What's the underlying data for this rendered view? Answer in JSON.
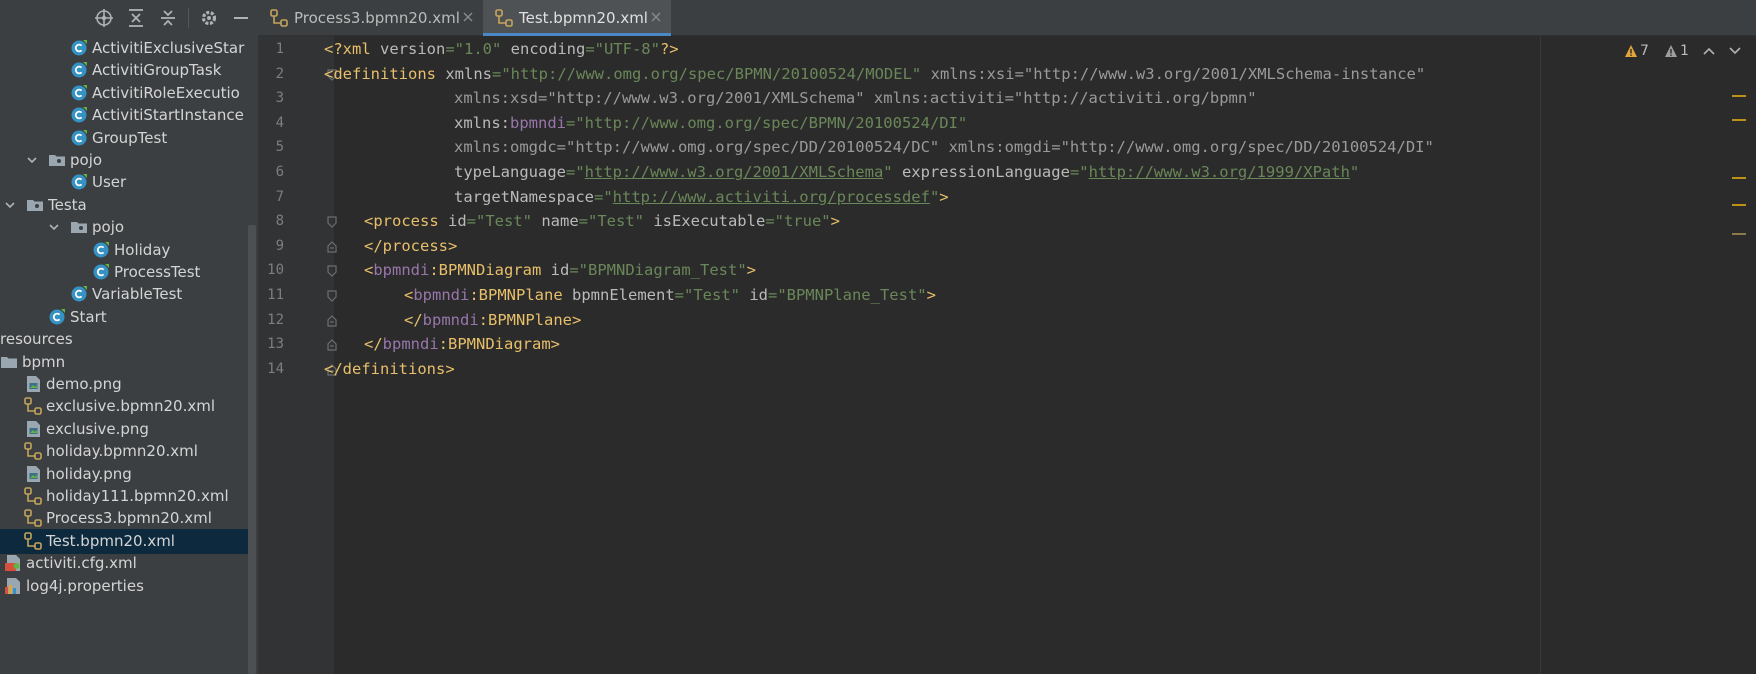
{
  "sidebar": {
    "toolbar": [
      "target-icon",
      "collapse-all-icon",
      "expand-all-icon",
      "gear-icon",
      "minimize-icon"
    ],
    "rows": [
      {
        "label": "ActivitiExclusiveStar",
        "icon": "java-class-icon",
        "indent": 70,
        "chevron": ""
      },
      {
        "label": "ActivitiGroupTask",
        "icon": "java-class-icon",
        "indent": 70,
        "chevron": ""
      },
      {
        "label": "ActivitiRoleExecutio",
        "icon": "java-class-icon",
        "indent": 70,
        "chevron": ""
      },
      {
        "label": "ActivitiStartInstance",
        "icon": "java-class-icon",
        "indent": 70,
        "chevron": ""
      },
      {
        "label": "GroupTest",
        "icon": "java-class-icon",
        "indent": 70,
        "chevron": ""
      },
      {
        "label": "pojo",
        "icon": "package-icon",
        "indent": 48,
        "chevron": "down"
      },
      {
        "label": "User",
        "icon": "java-class-icon",
        "indent": 70,
        "chevron": ""
      },
      {
        "label": "Testa",
        "icon": "package-icon",
        "indent": 26,
        "chevron": "down"
      },
      {
        "label": "pojo",
        "icon": "package-icon",
        "indent": 70,
        "chevron": "down"
      },
      {
        "label": "Holiday",
        "icon": "java-class-icon",
        "indent": 92,
        "chevron": ""
      },
      {
        "label": "ProcessTest",
        "icon": "java-class-icon",
        "indent": 92,
        "chevron": ""
      },
      {
        "label": "VariableTest",
        "icon": "java-class-icon",
        "indent": 70,
        "chevron": ""
      },
      {
        "label": "Start",
        "icon": "java-class-icon",
        "indent": 48,
        "chevron": ""
      },
      {
        "label": "resources",
        "icon": "",
        "indent": 0,
        "chevron": ""
      },
      {
        "label": "bpmn",
        "icon": "folder-icon",
        "indent": 0,
        "chevron": ""
      },
      {
        "label": "demo.png",
        "icon": "image-file-icon",
        "indent": 24,
        "chevron": ""
      },
      {
        "label": "exclusive.bpmn20.xml",
        "icon": "bpmn-file-icon",
        "indent": 24,
        "chevron": ""
      },
      {
        "label": "exclusive.png",
        "icon": "image-file-icon",
        "indent": 24,
        "chevron": ""
      },
      {
        "label": "holiday.bpmn20.xml",
        "icon": "bpmn-file-icon",
        "indent": 24,
        "chevron": ""
      },
      {
        "label": "holiday.png",
        "icon": "image-file-icon",
        "indent": 24,
        "chevron": ""
      },
      {
        "label": "holiday111.bpmn20.xml",
        "icon": "bpmn-file-icon",
        "indent": 24,
        "chevron": ""
      },
      {
        "label": "Process3.bpmn20.xml",
        "icon": "bpmn-file-icon",
        "indent": 24,
        "chevron": ""
      },
      {
        "label": "Test.bpmn20.xml",
        "icon": "bpmn-file-icon",
        "indent": 24,
        "chevron": "",
        "selected": true
      },
      {
        "label": "activiti.cfg.xml",
        "icon": "xml-config-icon",
        "indent": 4,
        "chevron": ""
      },
      {
        "label": "log4j.properties",
        "icon": "properties-file-icon",
        "indent": 4,
        "chevron": ""
      }
    ]
  },
  "tabs": [
    {
      "label": "Process3.bpmn20.xml",
      "active": false
    },
    {
      "label": "Test.bpmn20.xml",
      "active": true
    }
  ],
  "inspection": {
    "warnings": "7",
    "weak_warnings": "1"
  },
  "editor": {
    "lines": [
      {
        "n": "1",
        "fold": "",
        "indent": 0,
        "tokens": [
          [
            "t-tag",
            "<?xml "
          ],
          [
            "t-attr",
            "version"
          ],
          [
            "t-val",
            "=\"1.0\" "
          ],
          [
            "t-attr",
            "encoding"
          ],
          [
            "t-val",
            "=\"UTF-8\""
          ],
          [
            "t-tag",
            "?>"
          ]
        ]
      },
      {
        "n": "2",
        "fold": "open",
        "indent": 0,
        "tokens": [
          [
            "t-tag",
            "<definitions "
          ],
          [
            "t-attr",
            "xmlns"
          ],
          [
            "t-val",
            "=\"http://www.omg.org/spec/BPMN/20100524/MODEL\" "
          ],
          [
            "t-xsi",
            "xmlns:xsi=\"http://www.w3.org/2001/XMLSchema-instance\""
          ]
        ]
      },
      {
        "n": "3",
        "fold": "",
        "indent": 130,
        "tokens": [
          [
            "t-xsi",
            "xmlns:xsd=\"http://www.w3.org/2001/XMLSchema\" xmlns:activiti=\"http://activiti.org/bpmn\""
          ]
        ]
      },
      {
        "n": "4",
        "fold": "",
        "indent": 130,
        "tokens": [
          [
            "t-attr",
            "xmlns:"
          ],
          [
            "t-ns",
            "bpmndi"
          ],
          [
            "t-val",
            "=\"http://www.omg.org/spec/BPMN/20100524/DI\""
          ]
        ]
      },
      {
        "n": "5",
        "fold": "",
        "indent": 130,
        "tokens": [
          [
            "t-xsi",
            "xmlns:omgdc=\"http://www.omg.org/spec/DD/20100524/DC\" xmlns:omgdi=\"http://www.omg.org/spec/DD/20100524/DI\""
          ]
        ]
      },
      {
        "n": "6",
        "fold": "",
        "indent": 130,
        "tokens": [
          [
            "t-attr",
            "typeLanguage"
          ],
          [
            "t-val",
            "=\""
          ],
          [
            "t-val t-link",
            "http://www.w3.org/2001/XMLSchema"
          ],
          [
            "t-val",
            "\" "
          ],
          [
            "t-attr",
            "expressionLanguage"
          ],
          [
            "t-val",
            "=\""
          ],
          [
            "t-val t-link",
            "http://www.w3.org/1999/XPath"
          ],
          [
            "t-val",
            "\""
          ]
        ]
      },
      {
        "n": "7",
        "fold": "",
        "indent": 130,
        "tokens": [
          [
            "t-attr",
            "targetNamespace"
          ],
          [
            "t-val",
            "=\""
          ],
          [
            "t-val t-link",
            "http://www.activiti.org/processdef"
          ],
          [
            "t-val",
            "\""
          ],
          [
            "t-tag",
            ">"
          ]
        ]
      },
      {
        "n": "8",
        "fold": "open",
        "indent": 40,
        "tokens": [
          [
            "t-tag",
            "<process "
          ],
          [
            "t-attr",
            "id"
          ],
          [
            "t-val",
            "=\"Test\" "
          ],
          [
            "t-attr",
            "name"
          ],
          [
            "t-val",
            "=\"Test\" "
          ],
          [
            "t-attr",
            "isExecutable"
          ],
          [
            "t-val",
            "=\"true\""
          ],
          [
            "t-tag",
            ">"
          ]
        ]
      },
      {
        "n": "9",
        "fold": "close",
        "indent": 40,
        "tokens": [
          [
            "t-tag",
            "</process>"
          ]
        ]
      },
      {
        "n": "10",
        "fold": "open",
        "indent": 40,
        "tokens": [
          [
            "t-tag",
            "<"
          ],
          [
            "t-ns",
            "bpmndi"
          ],
          [
            "t-tag",
            ":BPMNDiagram "
          ],
          [
            "t-attr",
            "id"
          ],
          [
            "t-val",
            "=\"BPMNDiagram_Test\""
          ],
          [
            "t-tag",
            ">"
          ]
        ]
      },
      {
        "n": "11",
        "fold": "open",
        "indent": 80,
        "tokens": [
          [
            "t-tag",
            "<"
          ],
          [
            "t-ns",
            "bpmndi"
          ],
          [
            "t-tag",
            ":BPMNPlane "
          ],
          [
            "t-attr",
            "bpmnElement"
          ],
          [
            "t-val",
            "=\"Test\" "
          ],
          [
            "t-attr",
            "id"
          ],
          [
            "t-val",
            "=\"BPMNPlane_Test\""
          ],
          [
            "t-tag",
            ">"
          ]
        ]
      },
      {
        "n": "12",
        "fold": "close",
        "indent": 80,
        "tokens": [
          [
            "t-tag",
            "</"
          ],
          [
            "t-ns",
            "bpmndi"
          ],
          [
            "t-tag",
            ":BPMNPlane>"
          ]
        ]
      },
      {
        "n": "13",
        "fold": "close",
        "indent": 40,
        "tokens": [
          [
            "t-tag",
            "</"
          ],
          [
            "t-ns",
            "bpmndi"
          ],
          [
            "t-tag",
            ":BPMNDiagram>"
          ]
        ]
      },
      {
        "n": "14",
        "fold": "close",
        "indent": 0,
        "tokens": [
          [
            "t-tag",
            "</definitions>"
          ]
        ]
      }
    ]
  },
  "colors": {
    "warning_marker": "#be9117",
    "accent": "#4a88c7",
    "selection": "#0d293e"
  }
}
